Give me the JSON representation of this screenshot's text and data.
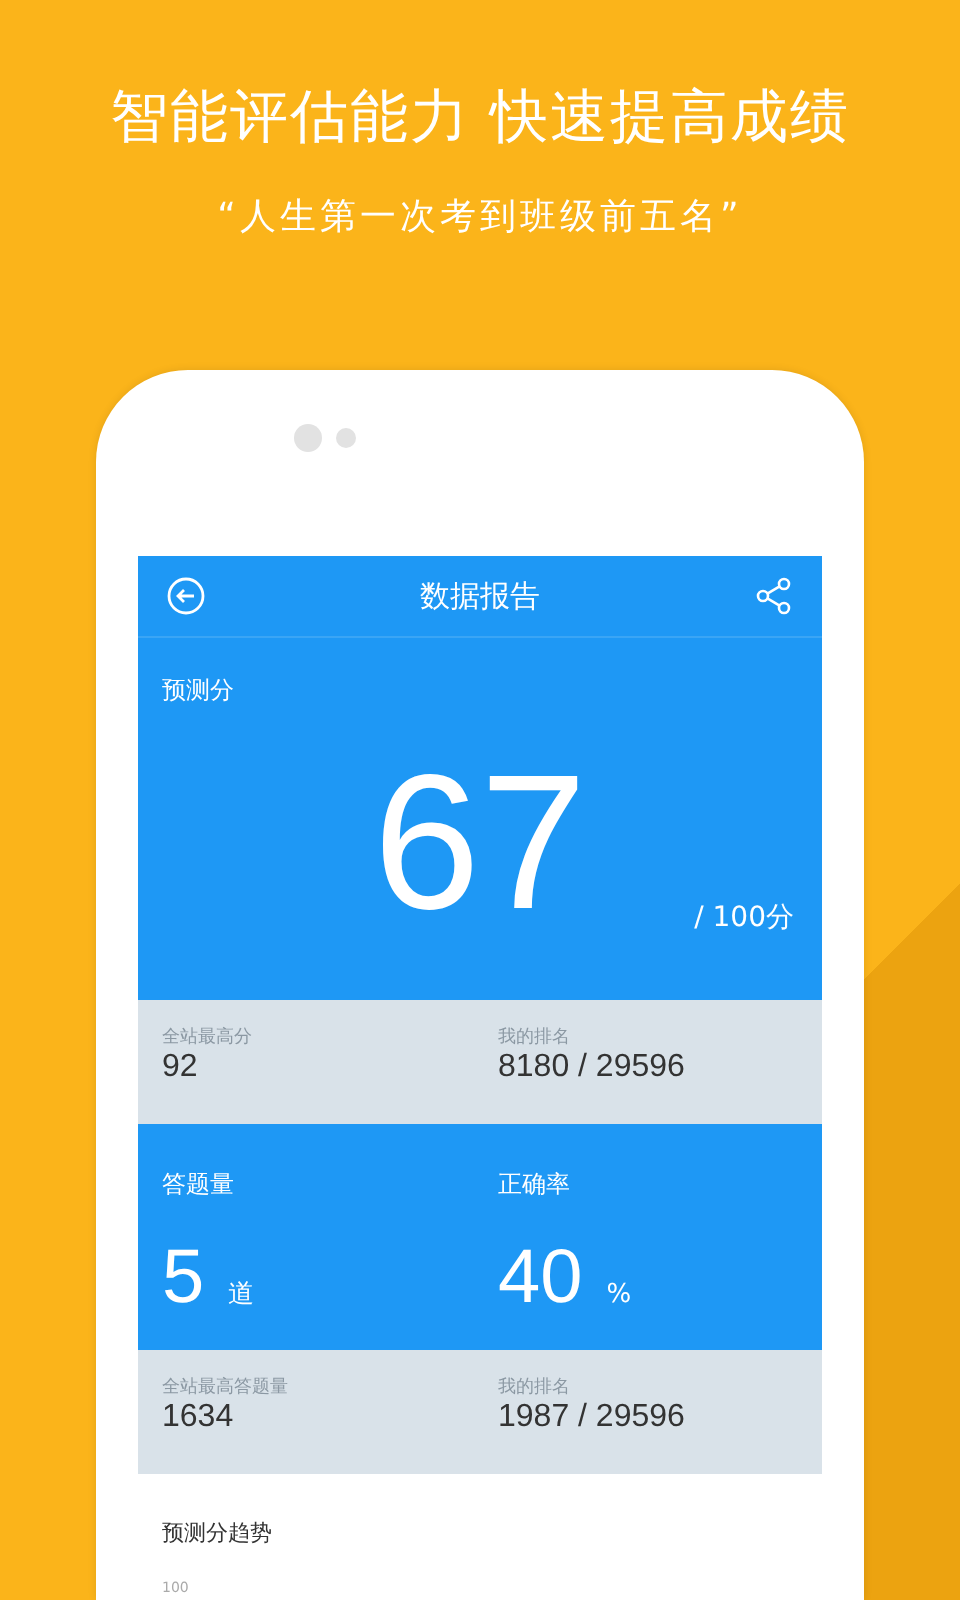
{
  "headline": "智能评估能力 快速提高成绩",
  "quote": "“人生第一次考到班级前五名”",
  "app_bar": {
    "title": "数据报告"
  },
  "prediction": {
    "label": "预测分",
    "score": "67",
    "total": "/ 100分"
  },
  "stat_rows": [
    {
      "kind": "rank",
      "cells": [
        {
          "label": "全站最高分",
          "value": "92"
        },
        {
          "label": "我的排名",
          "value": "8180 / 29596"
        }
      ]
    },
    {
      "kind": "metric",
      "cells": [
        {
          "label": "答题量",
          "value": "5",
          "unit": "道"
        },
        {
          "label": "正确率",
          "value": "40",
          "unit": "%"
        }
      ]
    },
    {
      "kind": "rank",
      "cells": [
        {
          "label": "全站最高答题量",
          "value": "1634"
        },
        {
          "label": "我的排名",
          "value": "1987 / 29596"
        }
      ]
    }
  ],
  "trend": {
    "title": "预测分趋势",
    "y_tick": "100"
  }
}
